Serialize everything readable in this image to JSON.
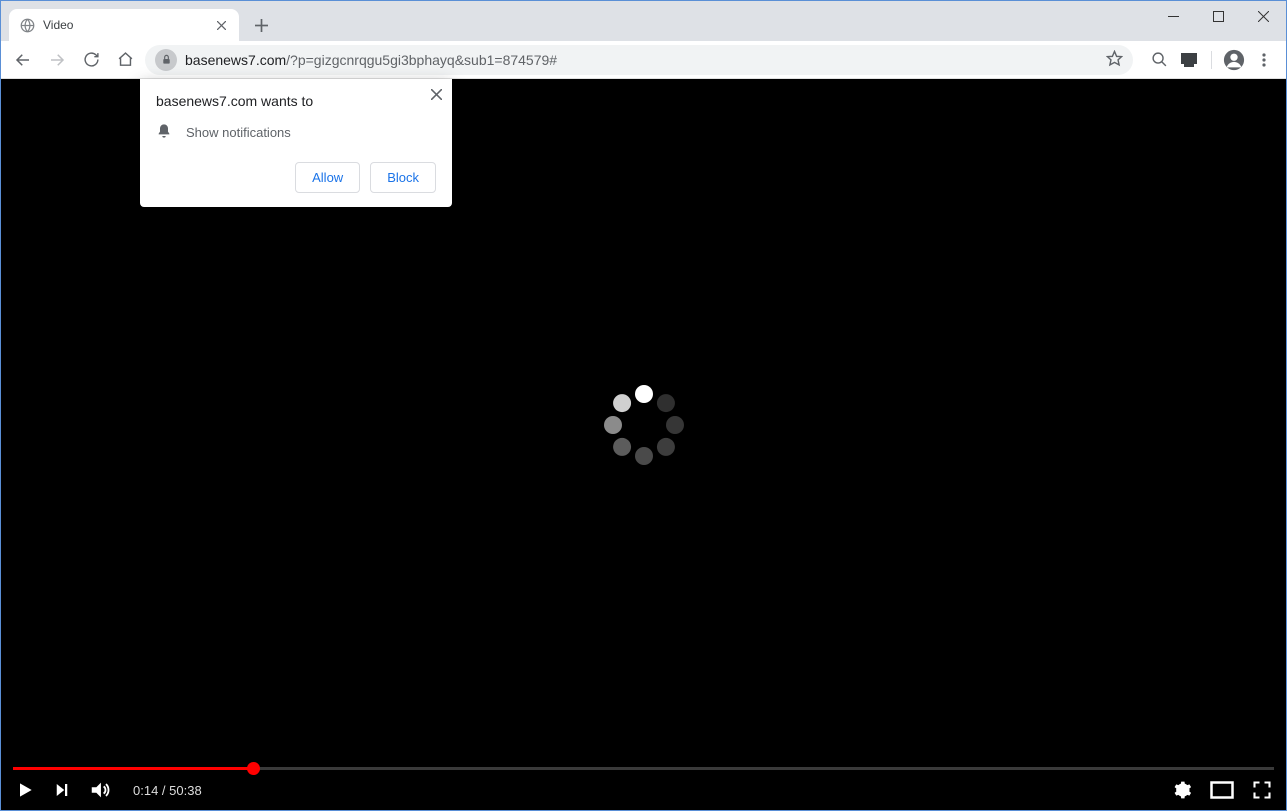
{
  "window": {
    "minimize_name": "minimize",
    "maximize_name": "maximize",
    "close_name": "close"
  },
  "tab": {
    "title": "Video"
  },
  "omnibox": {
    "host": "basenews7.com",
    "path": "/?p=gizgcnrqgu5gi3bphayq&sub1=874579#"
  },
  "permission_prompt": {
    "title": "basenews7.com wants to",
    "request": "Show notifications",
    "allow_label": "Allow",
    "block_label": "Block"
  },
  "video": {
    "current_time": "0:14",
    "duration": "50:38",
    "time_separator": " / ",
    "progress_percent": 19
  }
}
